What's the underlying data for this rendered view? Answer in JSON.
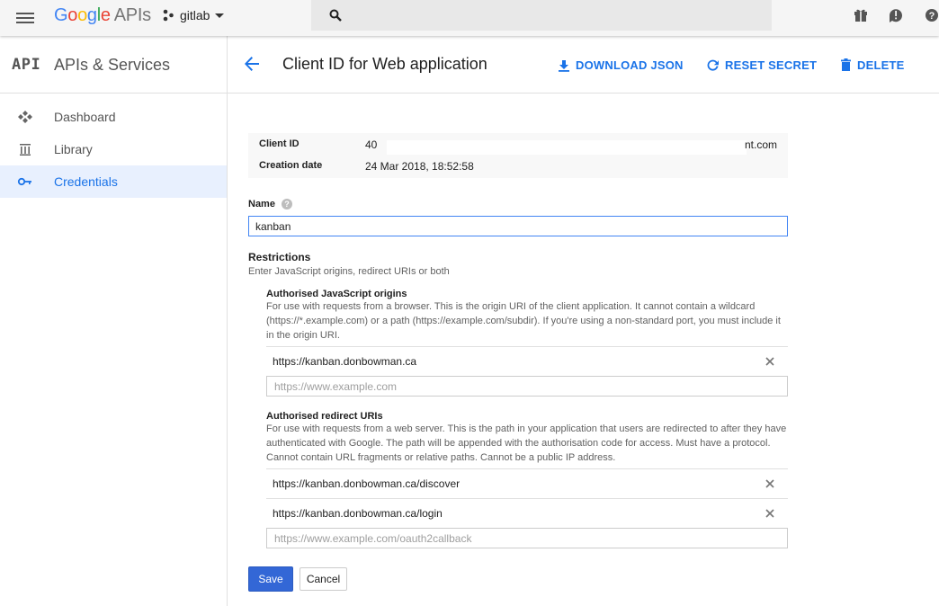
{
  "topbar": {
    "logo_google": [
      "G",
      "o",
      "o",
      "g",
      "l",
      "e"
    ],
    "logo_apis": "APIs",
    "project_name": "gitlab",
    "icons": [
      "menu-icon",
      "search-icon",
      "gift-icon",
      "feedback-icon",
      "help-icon"
    ]
  },
  "sidebar": {
    "api_mark": "API",
    "title": "APIs & Services",
    "items": [
      {
        "label": "Dashboard",
        "icon": "dashboard-icon"
      },
      {
        "label": "Library",
        "icon": "library-icon"
      },
      {
        "label": "Credentials",
        "icon": "key-icon",
        "active": true
      }
    ]
  },
  "header": {
    "title": "Client ID for Web application",
    "download_label": "DOWNLOAD JSON",
    "reset_label": "RESET SECRET",
    "delete_label": "DELETE"
  },
  "info": {
    "client_id_label": "Client ID",
    "client_id_start": "40",
    "client_id_end": "nt.com",
    "creation_date_label": "Creation date",
    "creation_date": "24 Mar 2018, 18:52:58"
  },
  "form": {
    "name_label": "Name",
    "name_value": "kanban",
    "restrictions_title": "Restrictions",
    "restrictions_desc": "Enter JavaScript origins, redirect URIs or both",
    "js_origins": {
      "title": "Authorised JavaScript origins",
      "desc": "For use with requests from a browser. This is the origin URI of the client application. It cannot contain a wildcard (https://*.example.com) or a path (https://example.com/subdir). If you're using a non-standard port, you must include it in the origin URI.",
      "items": [
        "https://kanban.donbowman.ca"
      ],
      "placeholder": "https://www.example.com"
    },
    "redirect_uris": {
      "title": "Authorised redirect URIs",
      "desc": "For use with requests from a web server. This is the path in your application that users are redirected to after they have authenticated with Google. The path will be appended with the authorisation code for access. Must have a protocol. Cannot contain URL fragments or relative paths. Cannot be a public IP address.",
      "items": [
        "https://kanban.donbowman.ca/discover",
        "https://kanban.donbowman.ca/login"
      ],
      "placeholder": "https://www.example.com/oauth2callback"
    },
    "save_label": "Save",
    "cancel_label": "Cancel"
  },
  "colors": {
    "accent": "#1a73e8",
    "save_button": "#3367d6",
    "active_nav_bg": "#e8f0fe"
  }
}
